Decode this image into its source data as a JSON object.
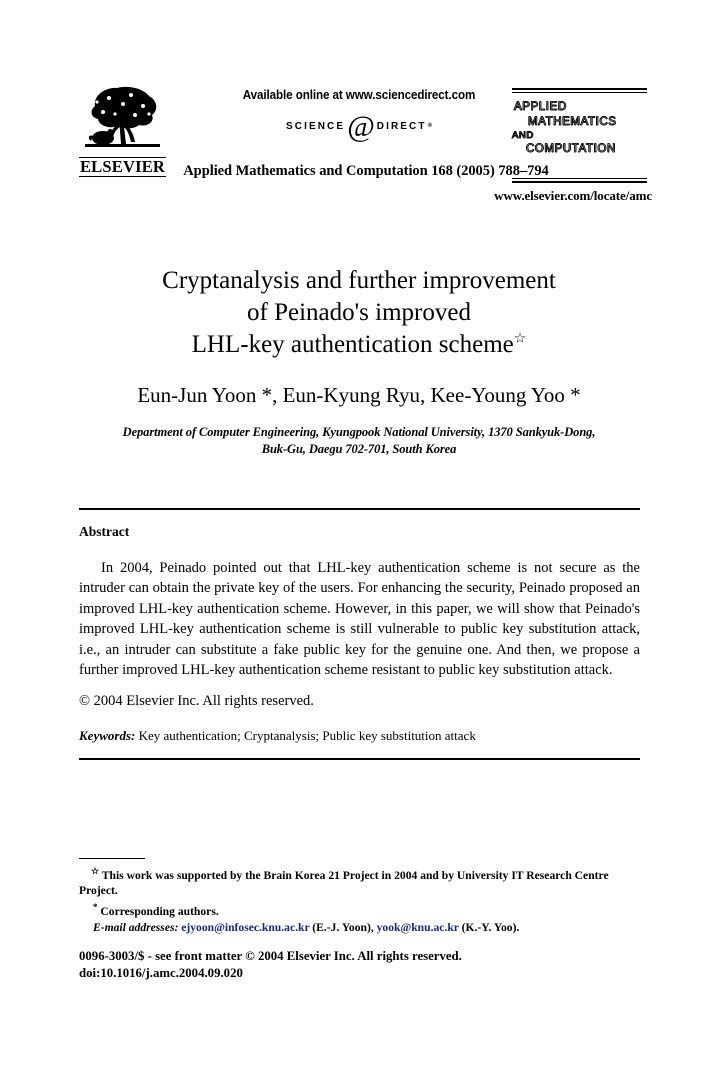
{
  "header": {
    "available_online": "Available online at www.sciencedirect.com",
    "sciencedirect_left": "SCIENCE",
    "sciencedirect_at": "@",
    "sciencedirect_right": "DIRECT",
    "sciencedirect_reg": "®",
    "publisher_name": "ELSEVIER",
    "journal_reference": "Applied Mathematics and Computation 168 (2005) 788–794",
    "masthead": {
      "line1": "APPLIED",
      "line2": "MATHEMATICS",
      "line3": "AND",
      "line4": "COMPUTATION"
    },
    "journal_url": "www.elsevier.com/locate/amc"
  },
  "article": {
    "title_line1": "Cryptanalysis and further improvement",
    "title_line2": "of Peinado's improved",
    "title_line3": "LHL-key authentication scheme",
    "title_footnote_marker": "☆",
    "authors": "Eun-Jun Yoon *, Eun-Kyung Ryu, Kee-Young Yoo *",
    "affiliation_line1": "Department of Computer Engineering, Kyungpook National University, 1370 Sankyuk-Dong,",
    "affiliation_line2": "Buk-Gu, Daegu 702-701, South Korea"
  },
  "abstract": {
    "heading": "Abstract",
    "body": "In 2004, Peinado pointed out that LHL-key authentication scheme is not secure as the intruder can obtain the private key of the users. For enhancing the security, Peinado proposed an improved LHL-key authentication scheme. However, in this paper, we will show that Peinado's improved LHL-key authentication scheme is still vulnerable to public key substitution attack, i.e., an intruder can substitute a fake public key for the genuine one. And then, we propose a further improved LHL-key authentication scheme resistant to public key substitution attack.",
    "copyright": "© 2004 Elsevier Inc. All rights reserved."
  },
  "keywords": {
    "label": "Keywords:",
    "values": "Key authentication; Cryptanalysis; Public key substitution attack"
  },
  "footnotes": {
    "star_marker": "☆",
    "funding": "This work was supported by the Brain Korea 21 Project in 2004 and by University IT Research Centre Project.",
    "corresponding_marker": "*",
    "corresponding": "Corresponding authors.",
    "email_label": "E-mail addresses:",
    "email_1": "ejyoon@infosec.knu.ac.kr",
    "email_1_author": "(E.-J. Yoon),",
    "email_2": "yook@knu.ac.kr",
    "email_2_author": "(K.-Y. Yoo)."
  },
  "imprint": {
    "issn_line": "0096-3003/$ - see front matter © 2004 Elsevier Inc. All rights reserved.",
    "doi_line": "doi:10.1016/j.amc.2004.09.020"
  },
  "colors": {
    "text": "#000000",
    "link": "#1b2a7a",
    "background": "#ffffff"
  }
}
